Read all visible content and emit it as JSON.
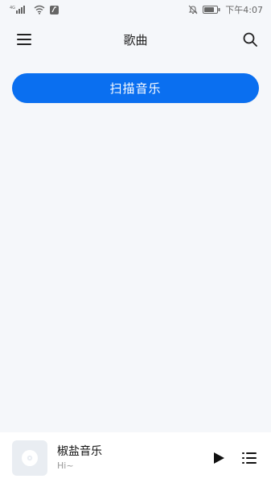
{
  "status_bar": {
    "signal_label": "4G",
    "time": "下午4:07",
    "icons": [
      "signal-icon",
      "wifi-icon",
      "notification-icon",
      "mute-icon",
      "battery-icon"
    ]
  },
  "header": {
    "title": "歌曲",
    "left_icon": "menu-icon",
    "right_icon": "search-icon"
  },
  "main": {
    "scan_button_label": "扫描音乐"
  },
  "player": {
    "track_title": "椒盐音乐",
    "track_subtitle": "Hi~",
    "controls": [
      "play-icon",
      "playlist-icon"
    ]
  },
  "colors": {
    "accent": "#0a6ff0",
    "background": "#f5f7fa",
    "player_bg": "#ffffff"
  }
}
